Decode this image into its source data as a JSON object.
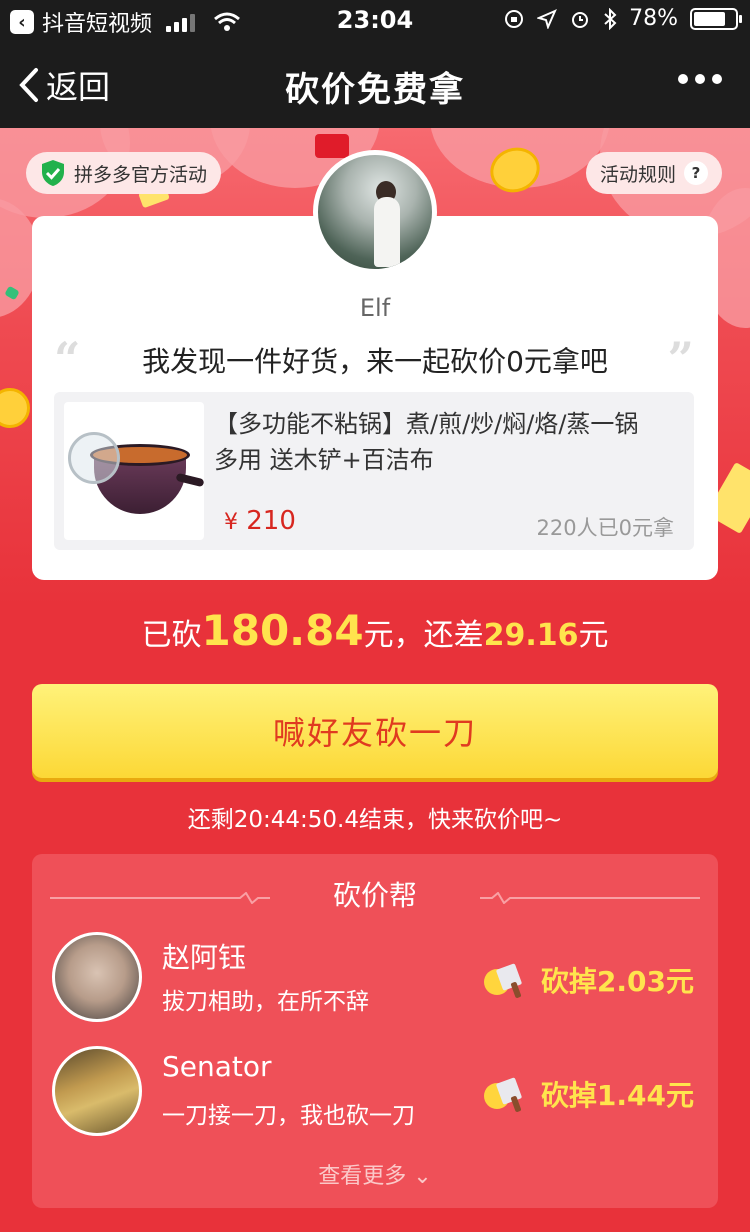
{
  "status_bar": {
    "back_app": "抖音短视频",
    "time": "23:04",
    "battery": "78%",
    "battery_level": 0.78
  },
  "nav": {
    "back_label": "返回",
    "title": "砍价免费拿"
  },
  "badges": {
    "official": "拼多多官方活动",
    "rules": "活动规则",
    "rules_icon": "?"
  },
  "card": {
    "user": "Elf",
    "message": "我发现一件好货，来一起砍价0元拿吧",
    "product": {
      "title": "【多功能不粘锅】煮/煎/炒/焖/烙/蒸一锅多用 送木铲+百洁布",
      "currency": "¥",
      "price": "210",
      "count": "220人已0元拿"
    }
  },
  "progress": {
    "prefix": "已砍",
    "cut": "180.84",
    "mid": "元，还差",
    "remaining": "29.16",
    "suffix": "元"
  },
  "cta_label": "喊好友砍一刀",
  "countdown": "还剩20:44:50.4结束，快来砍价吧~",
  "helpers": {
    "title": "砍价帮",
    "items": [
      {
        "name": "赵阿钰",
        "say": "拔刀相助，在所不辞",
        "amount": "砍掉2.03元"
      },
      {
        "name": "Senator",
        "say": "一刀接一刀，我也砍一刀",
        "amount": "砍掉1.44元"
      }
    ],
    "more": "查看更多"
  },
  "colors": {
    "accent_red": "#e8323a",
    "gold": "#ffe44d",
    "price_red": "#d7261f"
  },
  "icons": [
    "app-back-icon",
    "signal-icon",
    "wifi-icon",
    "battery-icon",
    "chevron-left-icon",
    "more-icon",
    "shield-check-icon",
    "question-icon",
    "cleaver-icon",
    "chevron-down-icon"
  ]
}
